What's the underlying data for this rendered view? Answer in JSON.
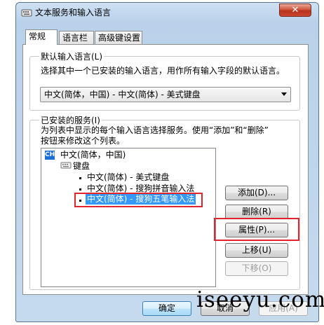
{
  "window": {
    "title": "文本服务和输入语言",
    "close_label": "✕"
  },
  "tabs": [
    {
      "label": "常规"
    },
    {
      "label": "语言栏"
    },
    {
      "label": "高级键设置"
    }
  ],
  "default_language": {
    "group_title": "默认输入语言(L)",
    "description": "选择其中一个已安装的输入语言，用作所有输入字段的默认语言。",
    "selected_value": "中文(简体，中国) - 中文(简体) - 美式键盘"
  },
  "installed_services": {
    "group_title": "已安装的服务(I)",
    "description_line1": "为列表中显示的每个输入语言选择服务。使用“添加”和“删除”",
    "description_line2": "按钮来修改这个列表。",
    "tree": {
      "language_badge": "CH",
      "language": "中文(简体，中国)",
      "category": "键盘",
      "items": [
        {
          "label": "中文(简体) - 美式键盘"
        },
        {
          "label": "中文(简体) - 搜狗拼音输入法"
        },
        {
          "label": "中文(简体) - 搜狗五笔输入法"
        }
      ]
    },
    "buttons": {
      "add": "添加(D)...",
      "remove": "删除(R)",
      "properties": "属性(P)...",
      "move_up": "上移(U)",
      "move_down": "下移(O)"
    }
  },
  "footer": {
    "ok": "确定",
    "cancel": "取消",
    "apply": "应用(A)"
  },
  "watermark": "iseeyu.com",
  "colors": {
    "highlight": "#e0262c",
    "selection": "#3399ff"
  }
}
